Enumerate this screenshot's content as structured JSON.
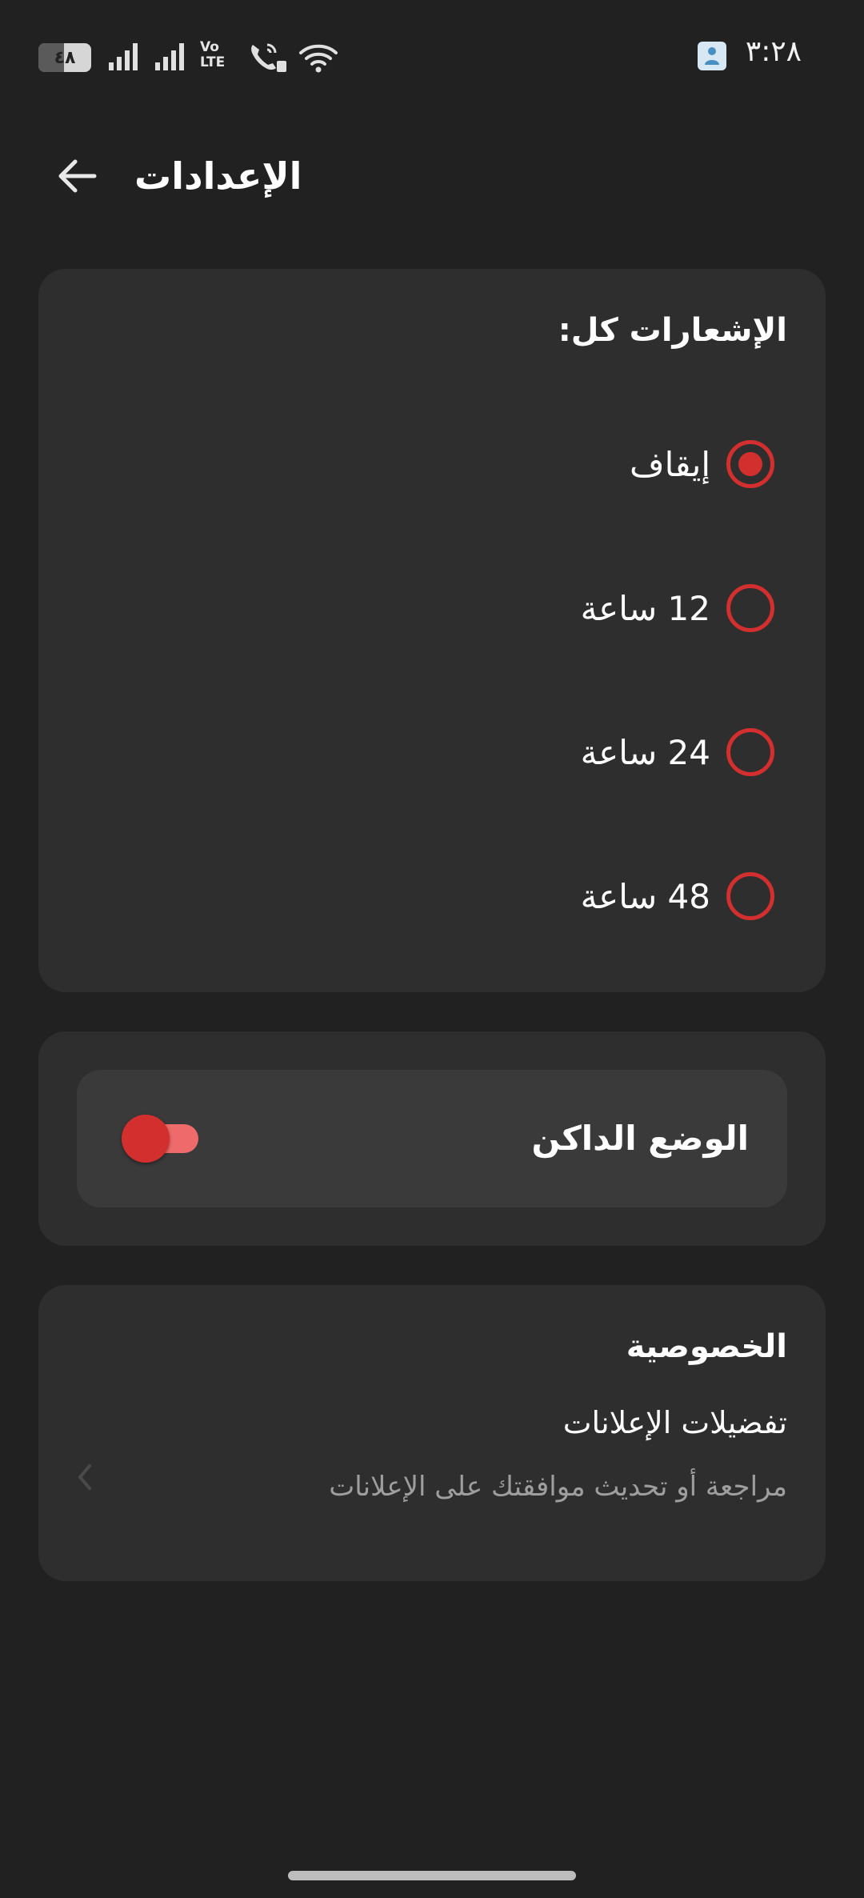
{
  "status_bar": {
    "time": "٣:٢٨",
    "battery": "٤٨",
    "battery_level": 0.48,
    "volte_top": "Vo",
    "volte_bottom": "LTE",
    "icons": [
      "notification-app-icon",
      "signal-icon",
      "signal-icon",
      "volte-icon",
      "wifi-calling-icon",
      "wifi-icon"
    ]
  },
  "app_bar": {
    "title": "الإعدادات",
    "back_icon": "arrow-back-icon"
  },
  "notifications": {
    "title": "الإشعارات كل:",
    "options": [
      {
        "label": "إيقاف",
        "selected": true
      },
      {
        "label": "12 ساعة",
        "selected": false
      },
      {
        "label": "24 ساعة",
        "selected": false
      },
      {
        "label": "48 ساعة",
        "selected": false
      }
    ],
    "accent_color": "#d32f2f"
  },
  "dark_mode": {
    "label": "الوضع الداكن",
    "enabled": true
  },
  "privacy": {
    "title": "الخصوصية",
    "item_title": "تفضيلات الإعلانات",
    "item_subtitle": "مراجعة أو تحديث موافقتك على الإعلانات",
    "chevron_icon": "chevron-left-icon"
  }
}
